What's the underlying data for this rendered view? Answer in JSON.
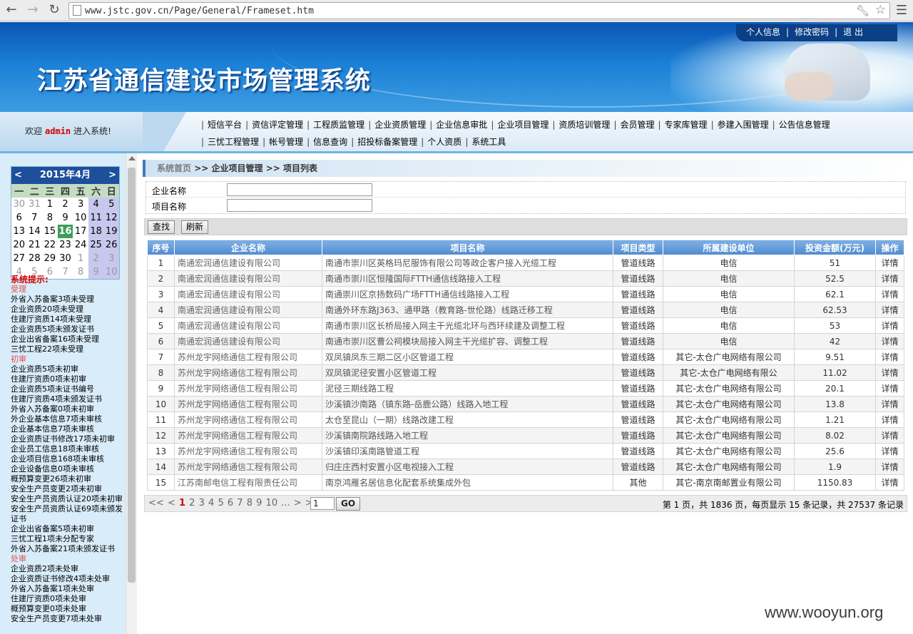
{
  "browser": {
    "url": "www.jstc.gov.cn/Page/General/Frameset.htm"
  },
  "header": {
    "title": "江苏省通信建设市场管理系统",
    "links": [
      "个人信息",
      "修改密码",
      "退 出"
    ],
    "separators": [
      "|",
      "|"
    ]
  },
  "welcome": {
    "prefix": "欢迎",
    "user": "admin",
    "suffix": "进入系统!"
  },
  "nav": {
    "row1": [
      "短信平台",
      "资信评定管理",
      "工程质监管理",
      "企业资质管理",
      "企业信息审批",
      "企业项目管理",
      "资质培训管理",
      "会员管理",
      "专家库管理",
      "参建入围管理",
      "公告信息管理"
    ],
    "row2": [
      "三忧工程管理",
      "帐号管理",
      "信息查询",
      "招投标备案管理",
      "个人资质",
      "系统工具"
    ]
  },
  "calendar": {
    "title": "2015年4月",
    "prev": "<",
    "next": ">",
    "weekdays": [
      "一",
      "二",
      "三",
      "四",
      "五",
      "六",
      "日"
    ],
    "weeks": [
      [
        "30",
        "31",
        "1",
        "2",
        "3",
        "4",
        "5"
      ],
      [
        "6",
        "7",
        "8",
        "9",
        "10",
        "11",
        "12"
      ],
      [
        "13",
        "14",
        "15",
        "16",
        "17",
        "18",
        "19"
      ],
      [
        "20",
        "21",
        "22",
        "23",
        "24",
        "25",
        "26"
      ],
      [
        "27",
        "28",
        "29",
        "30",
        "1",
        "2",
        "3"
      ],
      [
        "4",
        "5",
        "6",
        "7",
        "8",
        "9",
        "10"
      ]
    ],
    "today": "16"
  },
  "tips": {
    "title": "系统提示:",
    "group1_label": "受理",
    "group1": [
      "外省入苏备案3项未受理",
      "企业资质20项未受理",
      "住建厅资质14项未受理",
      "企业资质5项未颁发证书",
      "企业出省备案16项未受理",
      "三忧工程22项未受理"
    ],
    "group2_label": "初审",
    "group2": [
      "企业资质5项未初审",
      "住建厅资质0项未初审",
      "企业资质5项未证书编号",
      "住建厅资质4项未颁发证书",
      "外省入苏备案0项未初审",
      "外企业基本信息7项未审核",
      "企业基本信息7项未审核",
      "企业资质证书修改17项未初审",
      "企业员工信息18项未审核",
      "企业项目信息168项未审核",
      "企业设备信息0项未审核",
      "概预算变更26项未初审",
      "安全生产员变更2项未初审",
      "安全生产员资质认证20项未初审",
      "安全生产员资质认证69项未颁发证书",
      "企业出省备案5项未初审",
      "三忧工程1项未分配专家",
      "外省入苏备案21项未颁发证书"
    ],
    "group3_label": "处审",
    "group3": [
      "企业资质2项未处审",
      "企业资质证书修改4项未处审",
      "外省入苏备案1项未处审",
      "住建厅资质0项未处审",
      "概预算变更0项未处审",
      "安全生产员变更7项未处审"
    ]
  },
  "breadcrumb": {
    "home": "系统首页",
    "sep": ">>",
    "level1": "企业项目管理",
    "level2": "项目列表"
  },
  "search": {
    "company_label": "企业名称",
    "company_value": "",
    "project_label": "项目名称",
    "project_value": "",
    "find_button": "查找",
    "refresh_button": "刷新"
  },
  "table": {
    "columns": [
      "序号",
      "企业名称",
      "项目名称",
      "项目类型",
      "所属建设单位",
      "投资金额(万元)",
      "操作"
    ],
    "rows": [
      [
        "1",
        "南通宏润通信建设有限公司",
        "南通市崇川区英格玛尼服饰有限公司等政企客户接入光缆工程",
        "管道线路",
        "电信",
        "51",
        "详情"
      ],
      [
        "2",
        "南通宏润通信建设有限公司",
        "南通市崇川区恒隆国际FTTH通信线路接入工程",
        "管道线路",
        "电信",
        "52.5",
        "详情"
      ],
      [
        "3",
        "南通宏润通信建设有限公司",
        "南通崇川区京扬数码广场FTTH通信线路接入工程",
        "管道线路",
        "电信",
        "62.1",
        "详情"
      ],
      [
        "4",
        "南通宏润通信建设有限公司",
        "南通外环东路J363、通甲路（教育路-世伦路）线路迁移工程",
        "管道线路",
        "电信",
        "62.53",
        "详情"
      ],
      [
        "5",
        "南通宏润通信建设有限公司",
        "南通市崇川区长桥局接入网主干光缆北环与西环续建及调整工程",
        "管道线路",
        "电信",
        "53",
        "详情"
      ],
      [
        "6",
        "南通宏润通信建设有限公司",
        "南通市崇川区曹公祠模块局接入网主干光缆扩容、调整工程",
        "管道线路",
        "电信",
        "42",
        "详情"
      ],
      [
        "7",
        "苏州龙宇网络通信工程有限公司",
        "双凤镇凤东三期二区小区管道工程",
        "管道线路",
        "其它-太仓广电网络有限公司",
        "9.51",
        "详情"
      ],
      [
        "8",
        "苏州龙宇网络通信工程有限公司",
        "双凤镇泥径安置小区管道工程",
        "管道线路",
        "其它-太仓广电网络有限公",
        "11.02",
        "详情"
      ],
      [
        "9",
        "苏州龙宇网络通信工程有限公司",
        "泥径三期线路工程",
        "管道线路",
        "其它-太仓广电网络有限公司",
        "20.1",
        "详情"
      ],
      [
        "10",
        "苏州龙宇网络通信工程有限公司",
        "沙溪镇沙南路（镇东路-岳鹿公路）线路入地工程",
        "管道线路",
        "其它-太仓广电网络有限公司",
        "13.8",
        "详情"
      ],
      [
        "11",
        "苏州龙宇网络通信工程有限公司",
        "太仓至昆山（一期）线路改建工程",
        "管道线路",
        "其它-太仓广电网络有限公司",
        "1.21",
        "详情"
      ],
      [
        "12",
        "苏州龙宇网络通信工程有限公司",
        "沙溪镇南院路线路入地工程",
        "管道线路",
        "其它-太仓广电网络有限公司",
        "8.02",
        "详情"
      ],
      [
        "13",
        "苏州龙宇网络通信工程有限公司",
        "沙溪镇印溪南路管道工程",
        "管道线路",
        "其它-太仓广电网络有限公司",
        "25.6",
        "详情"
      ],
      [
        "14",
        "苏州龙宇网络通信工程有限公司",
        "归庄庄西村安置小区电视接入工程",
        "管道线路",
        "其它-太仓广电网络有限公司",
        "1.9",
        "详情"
      ],
      [
        "15",
        "江苏南邮电信工程有限责任公司",
        "南京鸿雁名居信息化配套系统集成外包",
        "其他",
        "其它-南京南邮置业有限公司",
        "1150.83",
        "详情"
      ]
    ]
  },
  "pager": {
    "first": "<<",
    "prev": "<",
    "current": "1",
    "pages": [
      "2",
      "3",
      "4",
      "5",
      "6",
      "7",
      "8",
      "9",
      "10",
      "..."
    ],
    "next": ">",
    "last": ">>",
    "input_value": "1",
    "go_button": "GO",
    "info": "第 1 页，共 1836 页，每页显示 15 条记录，共 27537 条记录"
  },
  "watermark": "www.wooyun.org"
}
